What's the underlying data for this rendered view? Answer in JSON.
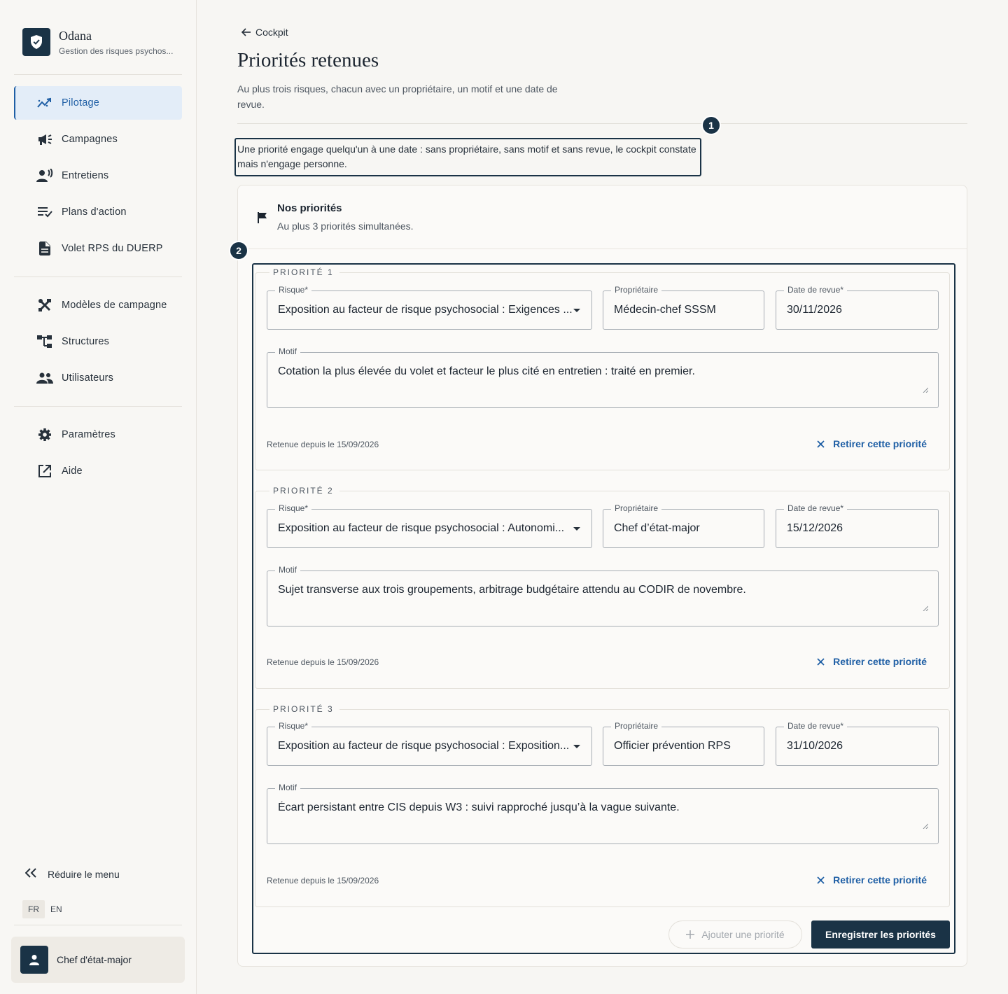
{
  "brand": {
    "name": "Odana",
    "subtitle": "Gestion des risques psychos..."
  },
  "sidebar": {
    "items": [
      {
        "label": "Pilotage",
        "icon": "chart-trend-icon",
        "active": true
      },
      {
        "label": "Campagnes",
        "icon": "megaphone-icon"
      },
      {
        "label": "Entretiens",
        "icon": "person-speaking-icon"
      },
      {
        "label": "Plans d'action",
        "icon": "checklist-icon"
      },
      {
        "label": "Volet RPS du DUERP",
        "icon": "document-icon"
      },
      {
        "label": "Modèles de campagne",
        "icon": "tools-icon"
      },
      {
        "label": "Structures",
        "icon": "hierarchy-icon"
      },
      {
        "label": "Utilisateurs",
        "icon": "users-icon"
      },
      {
        "label": "Paramètres",
        "icon": "gear-icon"
      },
      {
        "label": "Aide",
        "icon": "external-link-icon"
      }
    ],
    "reduce_label": "Réduire le menu",
    "languages": [
      "FR",
      "EN"
    ],
    "user": "Chef d'état-major"
  },
  "header": {
    "back_label": "Cockpit",
    "title": "Priorités retenues",
    "subtitle": "Au plus trois risques, chacun avec un propriétaire, un motif et une date de revue."
  },
  "steps": [
    "1",
    "2"
  ],
  "callout": "Une priorité engage quelqu'un à une date : sans propriétaire, sans motif et sans revue, le cockpit constate mais n'engage personne.",
  "card": {
    "title": "Nos priorités",
    "subtitle": "Au plus 3 priorités simultanées."
  },
  "labels": {
    "risk": "Risque*",
    "owner": "Propriétaire",
    "review_date": "Date de revue*",
    "reason": "Motif",
    "remove": "Retirer cette priorité"
  },
  "priorities": [
    {
      "legend": "PRIORITÉ 1",
      "risk": "Exposition au facteur de risque psychosocial : Exigences ...",
      "owner": "Médecin-chef SSSM",
      "review_date": "30/11/2026",
      "reason": "Cotation la plus élevée du volet et facteur le plus cité en entretien : traité en premier.",
      "since": "Retenue depuis le 15/09/2026"
    },
    {
      "legend": "PRIORITÉ 2",
      "risk": "Exposition au facteur de risque psychosocial : Autonomi...",
      "owner": "Chef d’état-major",
      "review_date": "15/12/2026",
      "reason": "Sujet transverse aux trois groupements, arbitrage budgétaire attendu au CODIR de novembre.",
      "since": "Retenue depuis le 15/09/2026"
    },
    {
      "legend": "PRIORITÉ 3",
      "risk": "Exposition au facteur de risque psychosocial : Exposition...",
      "owner": "Officier prévention RPS",
      "review_date": "31/10/2026",
      "reason": "Écart persistant entre CIS depuis W3 : suivi rapproché jusqu’à la vague suivante.",
      "since": "Retenue depuis le 15/09/2026"
    }
  ],
  "actions": {
    "add": "Ajouter une priorité",
    "save": "Enregistrer les priorités"
  },
  "colors": {
    "primary": "#1a3346",
    "accent": "#1f5fa5",
    "active_bg": "#e3edf8"
  }
}
